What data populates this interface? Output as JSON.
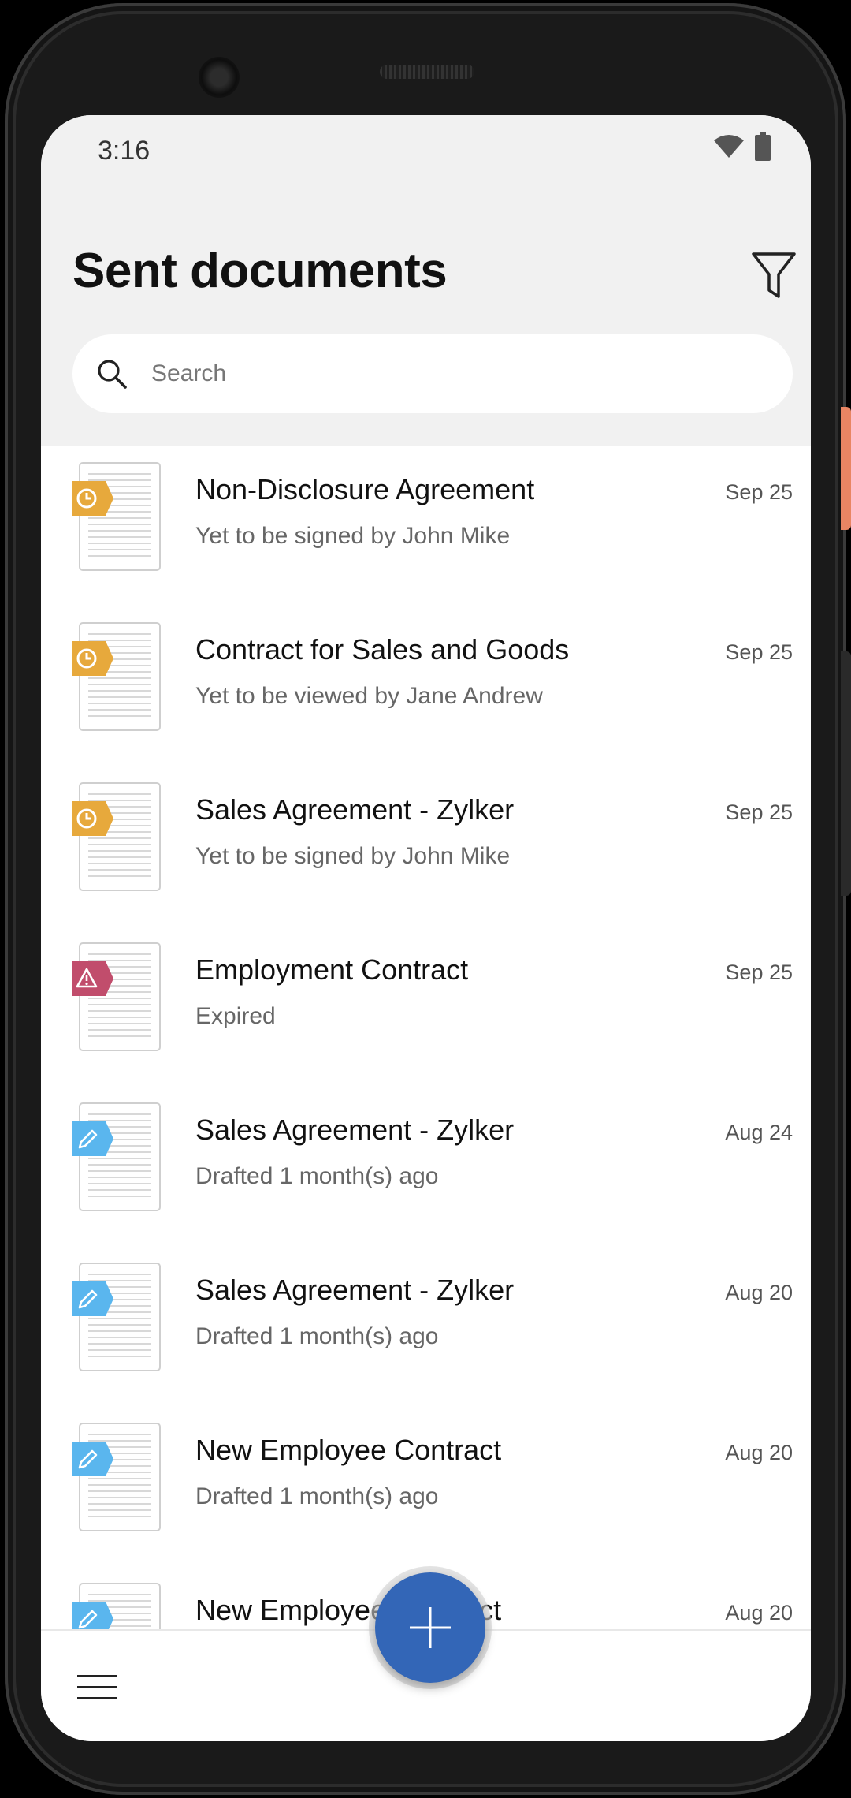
{
  "status_bar": {
    "time": "3:16"
  },
  "header": {
    "title": "Sent documents"
  },
  "search": {
    "placeholder": "Search"
  },
  "colors": {
    "pending": "#e7a93c",
    "expired": "#c14d6c",
    "draft": "#5ab6ee",
    "fab": "#3366b7"
  },
  "documents": [
    {
      "title": "Non-Disclosure Agreement",
      "status": "Yet to be signed by John Mike",
      "date": "Sep 25",
      "badge": "clock-icon"
    },
    {
      "title": "Contract for Sales and Goods",
      "status": "Yet to be viewed by Jane Andrew",
      "date": "Sep 25",
      "badge": "clock-icon"
    },
    {
      "title": "Sales Agreement - Zylker",
      "status": "Yet to be signed by John Mike",
      "date": "Sep 25",
      "badge": "clock-icon"
    },
    {
      "title": "Employment Contract",
      "status": "Expired",
      "date": "Sep 25",
      "badge": "warning-icon"
    },
    {
      "title": "Sales Agreement - Zylker",
      "status": "Drafted 1 month(s) ago",
      "date": "Aug 24",
      "badge": "pencil-icon"
    },
    {
      "title": "Sales Agreement - Zylker",
      "status": "Drafted 1 month(s) ago",
      "date": "Aug 20",
      "badge": "pencil-icon"
    },
    {
      "title": "New Employee Contract",
      "status": "Drafted 1 month(s) ago",
      "date": "Aug 20",
      "badge": "pencil-icon"
    },
    {
      "title": "New Employee Contract",
      "status": "",
      "date": "Aug 20",
      "badge": "pencil-icon"
    }
  ]
}
